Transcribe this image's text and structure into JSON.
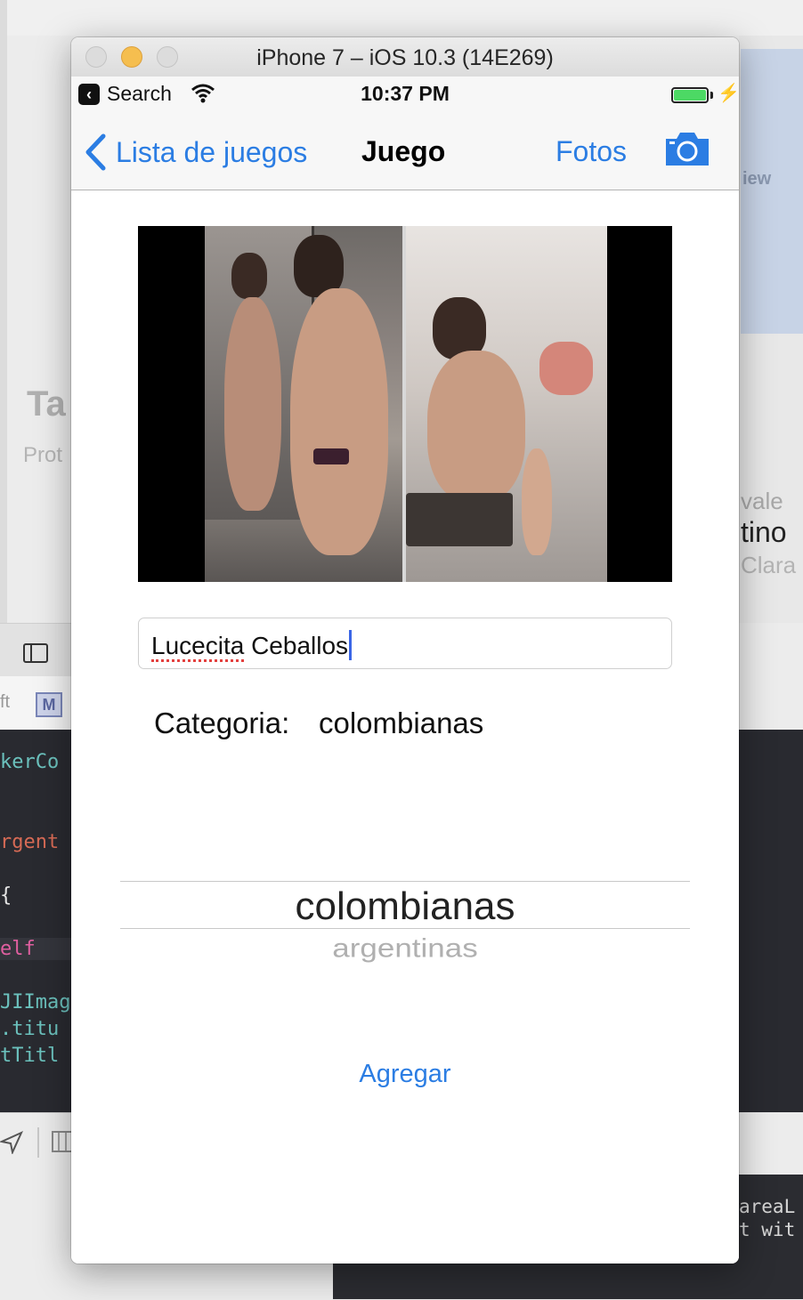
{
  "simulator": {
    "window_title": "iPhone 7 – iOS 10.3 (14E269)"
  },
  "status_bar": {
    "back_app": "Search",
    "time": "10:37 PM"
  },
  "nav_bar": {
    "back_label": "Lista de juegos",
    "title": "Juego",
    "fotos_label": "Fotos"
  },
  "form": {
    "name_value": "Lucecita Ceballos",
    "name_first": "Lucecita",
    "name_rest": " Ceballos",
    "category_label": "Categoria:",
    "category_value": "colombianas"
  },
  "picker": {
    "selected": "colombianas",
    "next": "argentinas"
  },
  "actions": {
    "add_label": "Agregar"
  },
  "background": {
    "left_label_1": "Ta",
    "left_label_2": "Prot",
    "right_label_1": "iew",
    "right_label_2": "vale",
    "right_label_3": "tino",
    "right_label_4": "Clara",
    "code_lines": [
      "kerCo",
      "rgent",
      "{",
      "elf",
      "JIImag",
      ".titu",
      "tTitl"
    ],
    "code_right_1": "areaL",
    "code_right_2": "t wit",
    "path_left": "ft"
  },
  "colors": {
    "ios_blue": "#2b7de3",
    "battery_green": "#4cd964",
    "code_bg": "#292a30"
  },
  "icons": [
    "back-chevron-icon",
    "wifi-icon",
    "battery-icon",
    "bolt-icon",
    "camera-icon"
  ]
}
